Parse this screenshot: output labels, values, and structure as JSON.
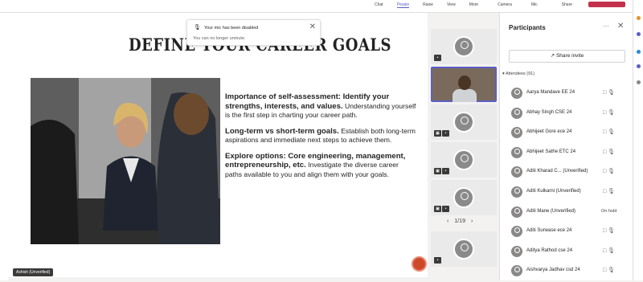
{
  "topnav": {
    "items": [
      {
        "label": "Chat",
        "active": false
      },
      {
        "label": "People",
        "active": true
      },
      {
        "label": "Raise",
        "active": false
      },
      {
        "label": "View",
        "active": false
      },
      {
        "label": "More",
        "active": false
      },
      {
        "label": "Camera",
        "active": false
      },
      {
        "label": "Mic",
        "active": false
      },
      {
        "label": "Share",
        "active": false
      }
    ]
  },
  "notification": {
    "title": "Your mic has been disabled",
    "subtitle": "You can no longer unmute."
  },
  "slide": {
    "title": "DEFINE YOUR CAREER GOALS",
    "points": [
      {
        "heading": "Importance of self-assessment: Identify your strengths, interests, and values.",
        "text": "Understanding yourself is the first step in charting your career path."
      },
      {
        "heading": "Long-term vs short-term goals.",
        "text": "Establish both long-term aspirations and immediate next steps to achieve them."
      },
      {
        "heading": "Explore options: Core engineering, management, entrepreneurship, etc.",
        "text": "Investigate the diverse career paths available to you and align them with your goals."
      }
    ]
  },
  "presenter": {
    "name": "Ashish (Unverified)"
  },
  "pager": {
    "prev": "‹",
    "label": "1/19",
    "next": "›"
  },
  "panel": {
    "title": "Participants",
    "more": "···",
    "close": "✕",
    "share_invite": "Share invite",
    "attendees_label": "Attendees (91)",
    "participants": [
      {
        "name": "Aarya Mandave EE 24",
        "status": ""
      },
      {
        "name": "Abhay Singh CSE 24",
        "status": ""
      },
      {
        "name": "Abhijeet Gore ece 24",
        "status": ""
      },
      {
        "name": "Abhijeet Sathe ETC 24",
        "status": ""
      },
      {
        "name": "Aditi Kharad C... (Unverified)",
        "status": ""
      },
      {
        "name": "Aditi Kulkarni (Unverified)",
        "status": ""
      },
      {
        "name": "Aditi Mane (Unverified)",
        "status": "On hold"
      },
      {
        "name": "Aditi Surwase ece 24",
        "status": ""
      },
      {
        "name": "Aditya Rathod cse 24",
        "status": ""
      },
      {
        "name": "Aishvarya Jadhav csd 24",
        "status": ""
      }
    ]
  },
  "colors": {
    "accent": "#5b5fc7",
    "leave": "#c4314b",
    "record": "#cc4a2a"
  }
}
